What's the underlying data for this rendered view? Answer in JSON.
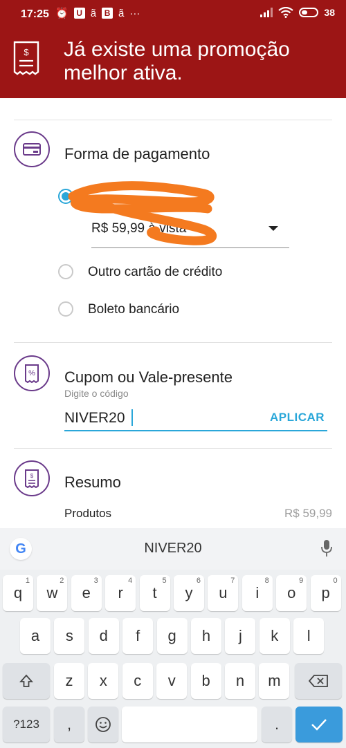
{
  "status_bar": {
    "time": "17:25",
    "battery": "38"
  },
  "promo_banner": {
    "text": "Já existe uma promoção melhor ativa."
  },
  "payment": {
    "title": "Forma de pagamento",
    "selected_option_value": "R$ 59,99 à vista",
    "options": [
      {
        "label": "Outro cartão de crédito"
      },
      {
        "label": "Boleto bancário"
      }
    ]
  },
  "coupon": {
    "title": "Cupom ou Vale-presente",
    "hint": "Digite o código",
    "value": "NIVER20",
    "apply_label": "APLICAR"
  },
  "summary": {
    "title": "Resumo",
    "products_label": "Produtos",
    "products_value": "R$ 59,99"
  },
  "keyboard": {
    "suggestion": "NIVER20",
    "row1": [
      {
        "k": "q",
        "h": "1"
      },
      {
        "k": "w",
        "h": "2"
      },
      {
        "k": "e",
        "h": "3"
      },
      {
        "k": "r",
        "h": "4"
      },
      {
        "k": "t",
        "h": "5"
      },
      {
        "k": "y",
        "h": "6"
      },
      {
        "k": "u",
        "h": "7"
      },
      {
        "k": "i",
        "h": "8"
      },
      {
        "k": "o",
        "h": "9"
      },
      {
        "k": "p",
        "h": "0"
      }
    ],
    "row2": [
      "a",
      "s",
      "d",
      "f",
      "g",
      "h",
      "j",
      "k",
      "l"
    ],
    "row3": [
      "z",
      "x",
      "c",
      "v",
      "b",
      "n",
      "m"
    ],
    "sym_label": "?123",
    "comma": ",",
    "period": "."
  },
  "colors": {
    "header_red": "#9c1515",
    "accent_blue": "#2aa7d9",
    "icon_purple": "#6a3a8a",
    "scribble_orange": "#f47a1f"
  }
}
